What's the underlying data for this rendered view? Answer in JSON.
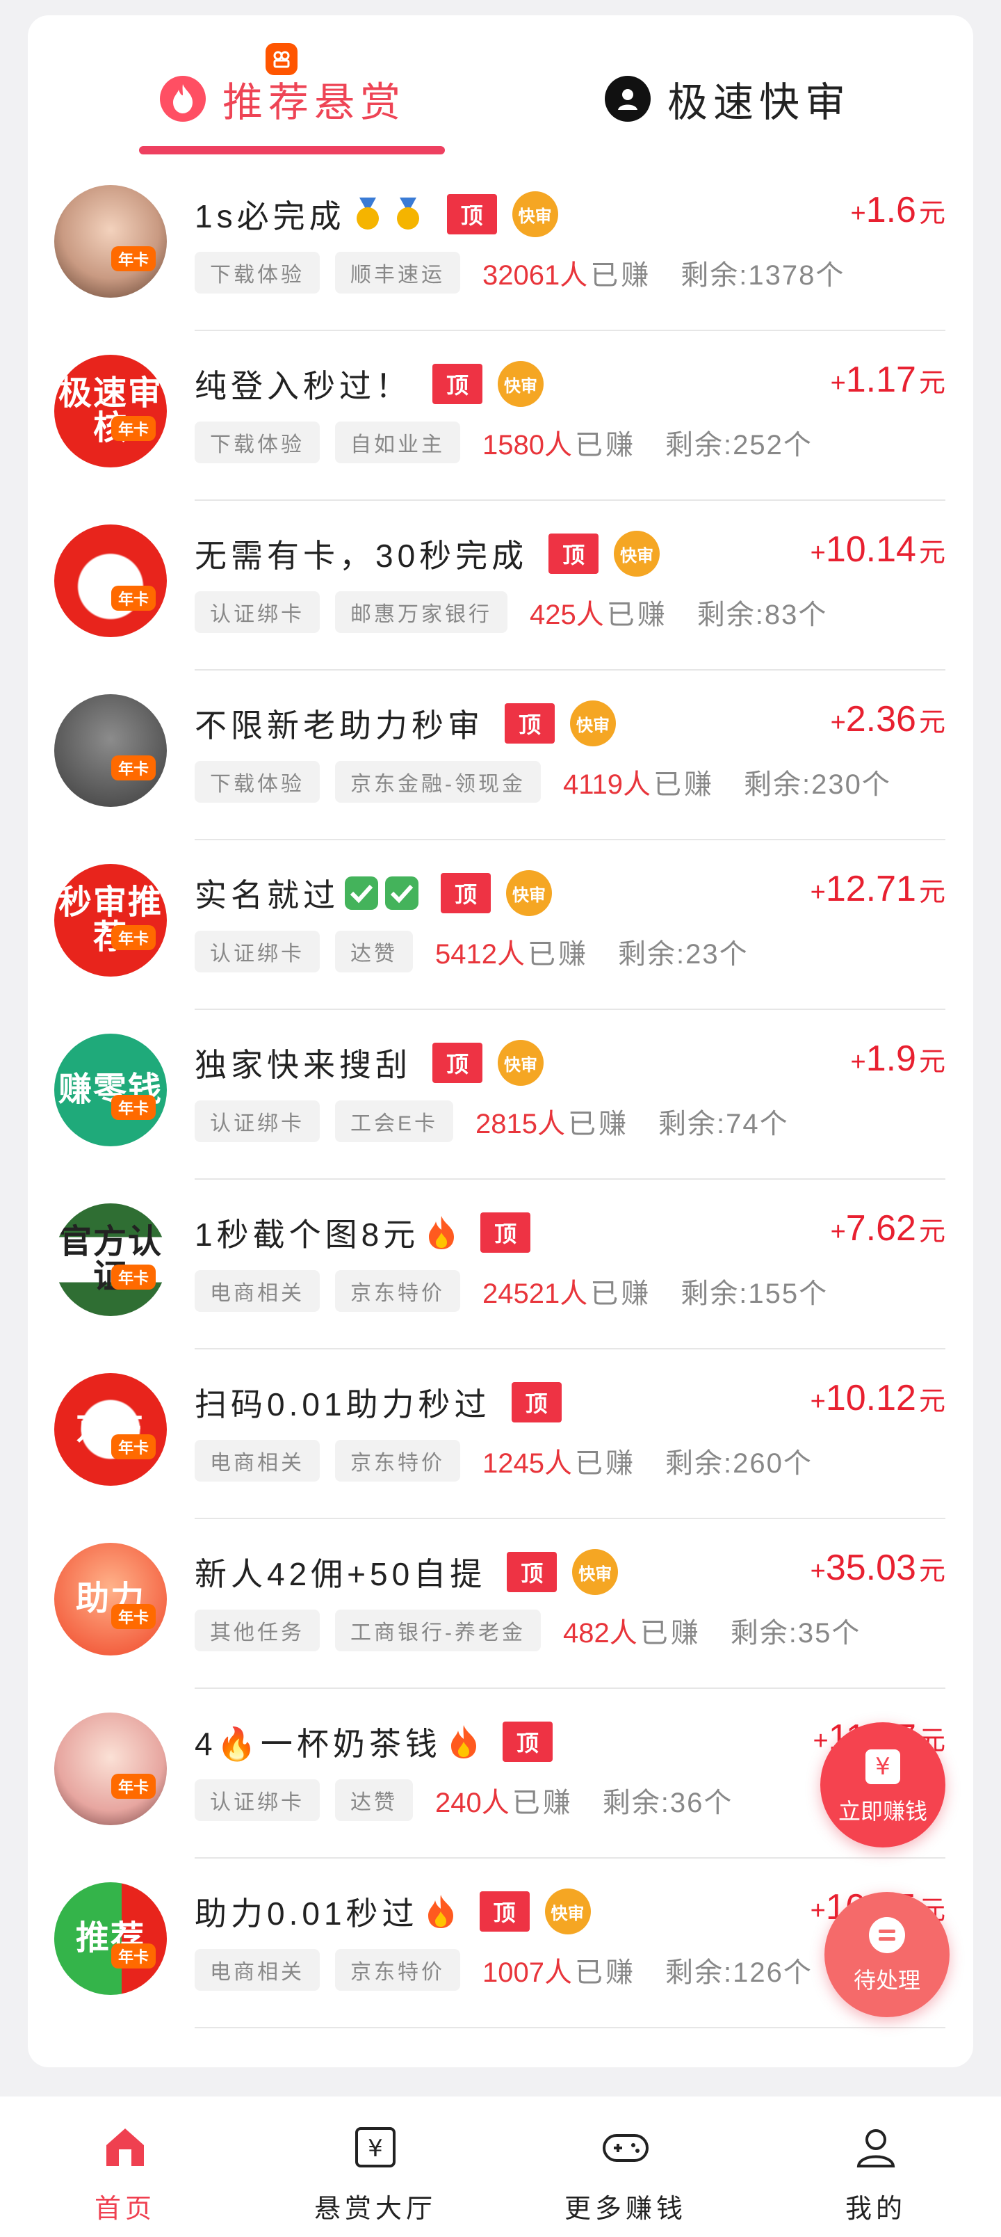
{
  "tabs": {
    "recommended": "推荐悬赏",
    "fast_review": "极速快审"
  },
  "badges": {
    "top": "顶",
    "fast": "快审",
    "annual": "年卡"
  },
  "reward_unit": "元",
  "earned_suffix": "已赚",
  "tasks": [
    {
      "title": "1s必完成",
      "emoji": "medals",
      "fast": true,
      "tag1": "下载体验",
      "tag2": "顺丰速运",
      "earned": "32061人",
      "remaining": "剩余:1378个",
      "reward": "1.6",
      "avatar_type": "photo",
      "avatar_text": ""
    },
    {
      "title": "纯登入秒过！",
      "emoji": "",
      "fast": true,
      "tag1": "下载体验",
      "tag2": "自如业主",
      "earned": "1580人",
      "remaining": "剩余:252个",
      "reward": "1.17",
      "avatar_type": "red",
      "avatar_text": "极速审核"
    },
    {
      "title": "无需有卡，30秒完成",
      "emoji": "",
      "fast": true,
      "tag1": "认证绑卡",
      "tag2": "邮惠万家银行",
      "earned": "425人",
      "remaining": "剩余:83个",
      "reward": "10.14",
      "avatar_type": "dog",
      "avatar_text": ""
    },
    {
      "title": "不限新老助力秒审",
      "emoji": "",
      "fast": true,
      "tag1": "下载体验",
      "tag2": "京东金融-领现金",
      "earned": "4119人",
      "remaining": "剩余:230个",
      "reward": "2.36",
      "avatar_type": "dark",
      "avatar_text": ""
    },
    {
      "title": "实名就过",
      "emoji": "checks",
      "fast": true,
      "tag1": "认证绑卡",
      "tag2": "达赞",
      "earned": "5412人",
      "remaining": "剩余:23个",
      "reward": "12.71",
      "avatar_type": "red",
      "avatar_text": "秒审推荐"
    },
    {
      "title": "独家快来搜刮",
      "emoji": "",
      "fast": true,
      "tag1": "认证绑卡",
      "tag2": "工会E卡",
      "earned": "2815人",
      "remaining": "剩余:74个",
      "reward": "1.9",
      "avatar_type": "green",
      "avatar_text": "赚零钱"
    },
    {
      "title": "1秒截个图8元",
      "emoji": "fire",
      "fast": false,
      "tag1": "电商相关",
      "tag2": "京东特价",
      "earned": "24521人",
      "remaining": "剩余:155个",
      "reward": "7.62",
      "avatar_type": "official",
      "avatar_text": "官方认证"
    },
    {
      "title": "扫码0.01助力秒过",
      "emoji": "",
      "fast": false,
      "tag1": "电商相关",
      "tag2": "京东特价",
      "earned": "1245人",
      "remaining": "剩余:260个",
      "reward": "10.12",
      "avatar_type": "jd",
      "avatar_text": "京东"
    },
    {
      "title": "新人42佣+50自提",
      "emoji": "",
      "fast": true,
      "tag1": "其他任务",
      "tag2": "工商银行-养老金",
      "earned": "482人",
      "remaining": "剩余:35个",
      "reward": "35.03",
      "avatar_type": "rocket",
      "avatar_text": "助力"
    },
    {
      "title": "4🔥一杯奶茶钱",
      "emoji": "fire",
      "fast": false,
      "tag1": "认证绑卡",
      "tag2": "达赞",
      "earned": "240人",
      "remaining": "剩余:36个",
      "reward": "11.57",
      "avatar_type": "photo2",
      "avatar_text": ""
    },
    {
      "title": "助力0.01秒过",
      "emoji": "fire",
      "fast": true,
      "tag1": "电商相关",
      "tag2": "京东特价",
      "earned": "1007人",
      "remaining": "剩余:126个",
      "reward": "10.15",
      "avatar_type": "greenred",
      "avatar_text": "推荐"
    }
  ],
  "floating": {
    "earn_now": "立即赚钱",
    "pending": "待处理"
  },
  "nav": {
    "home": "首页",
    "reward_hall": "悬赏大厅",
    "more_money": "更多赚钱",
    "mine": "我的"
  },
  "colors": {
    "accent": "#ee4055",
    "reward": "#e82030",
    "fast_badge": "#f5a623"
  }
}
